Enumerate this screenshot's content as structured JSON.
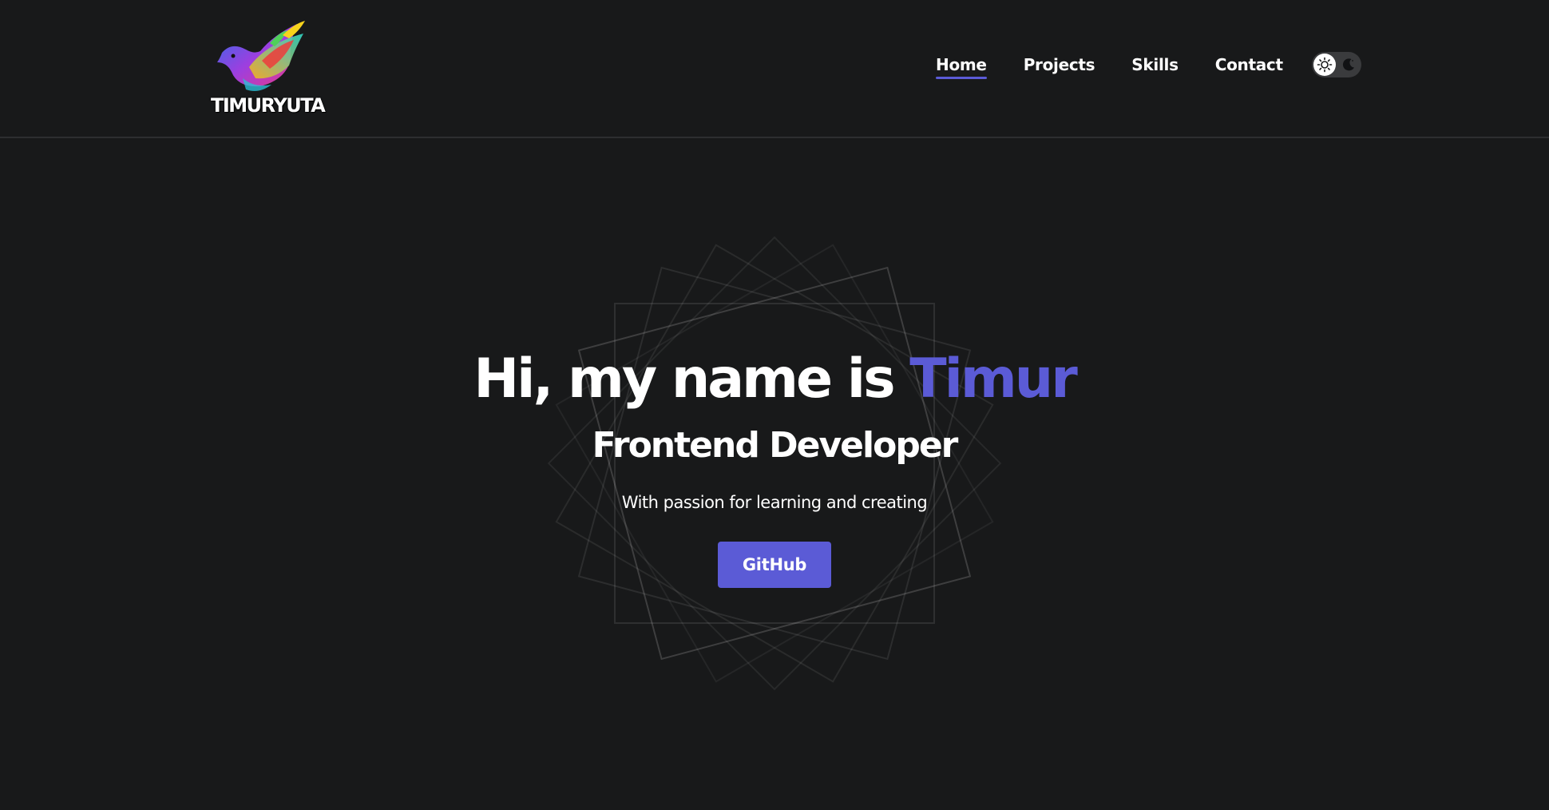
{
  "header": {
    "logo_text": "TIMURYUTA",
    "nav": [
      {
        "label": "Home",
        "active": true
      },
      {
        "label": "Projects",
        "active": false
      },
      {
        "label": "Skills",
        "active": false
      },
      {
        "label": "Contact",
        "active": false
      }
    ],
    "theme_toggle": {
      "icons": [
        "sun-icon",
        "moon-icon"
      ]
    }
  },
  "hero": {
    "title_prefix": "Hi, my name is ",
    "title_name": "Timur",
    "subtitle": "Frontend Developer",
    "tagline": "With passion for learning and creating",
    "cta_label": "GitHub"
  },
  "colors": {
    "background": "#18191a",
    "accent": "#5b5bd6",
    "text": "#ffffff",
    "toggle_track": "#3a3b3d"
  }
}
